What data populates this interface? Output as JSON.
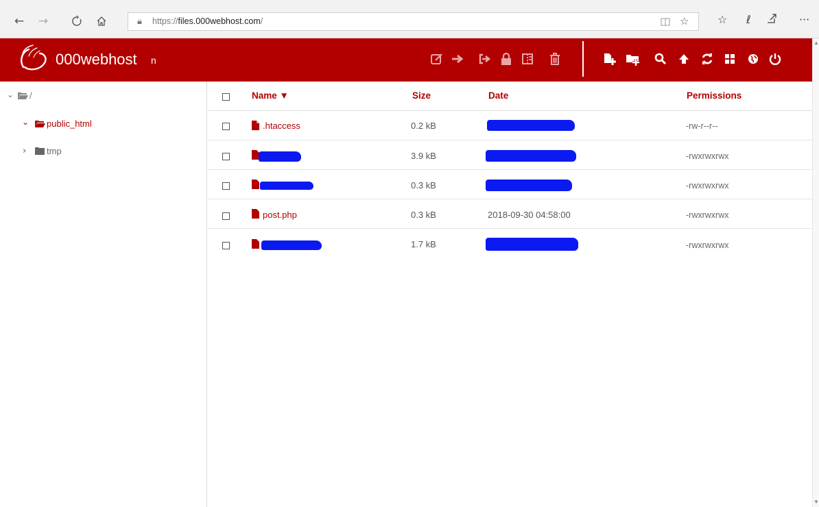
{
  "browser": {
    "url_prefix": "https://",
    "url_host": "files.000webhost.com",
    "url_suffix": "/",
    "icons": [
      "back-icon",
      "forward-icon",
      "refresh-icon",
      "home-icon",
      "lock-icon",
      "reading-view-icon",
      "favorite-star-icon",
      "favorites-icon",
      "pen-icon",
      "share-icon",
      "more-icon"
    ],
    "more_label": "···"
  },
  "header": {
    "logo_text": "000webhost",
    "user": "n",
    "background": "#b20000",
    "disabled_tools": [
      "edit-icon",
      "move-icon",
      "rename-icon",
      "lock-icon",
      "archive-icon",
      "trash-icon"
    ],
    "tools": [
      "new-file-icon",
      "new-folder-icon",
      "search-icon",
      "upload-icon",
      "refresh-icon",
      "grid-view-icon",
      "globe-icon",
      "power-icon"
    ]
  },
  "sidebar": {
    "root": "/",
    "items": [
      {
        "label": "public_html",
        "expanded": true,
        "active": true
      },
      {
        "label": "tmp",
        "expanded": false,
        "active": false
      }
    ]
  },
  "table": {
    "columns": {
      "name": "Name ▼",
      "size": "Size",
      "date": "Date",
      "permissions": "Permissions"
    },
    "rows": [
      {
        "name": ".htaccess",
        "size": "0.2 kB",
        "date": "",
        "permissions": "-rw-r--r--",
        "name_redacted": false,
        "date_redacted": true
      },
      {
        "name": "",
        "size": "3.9 kB",
        "date": "",
        "permissions": "-rwxrwxrwx",
        "name_redacted": true,
        "date_redacted": true
      },
      {
        "name": "",
        "size": "0.3 kB",
        "date": "",
        "permissions": "-rwxrwxrwx",
        "name_redacted": true,
        "date_redacted": true
      },
      {
        "name": "post.php",
        "size": "0.3 kB",
        "date": "2018-09-30 04:58:00",
        "permissions": "-rwxrwxrwx",
        "name_redacted": false,
        "date_redacted": false
      },
      {
        "name": "",
        "size": "1.7 kB",
        "date": "",
        "permissions": "-rwxrwxrwx",
        "name_redacted": true,
        "date_redacted": true
      }
    ]
  }
}
